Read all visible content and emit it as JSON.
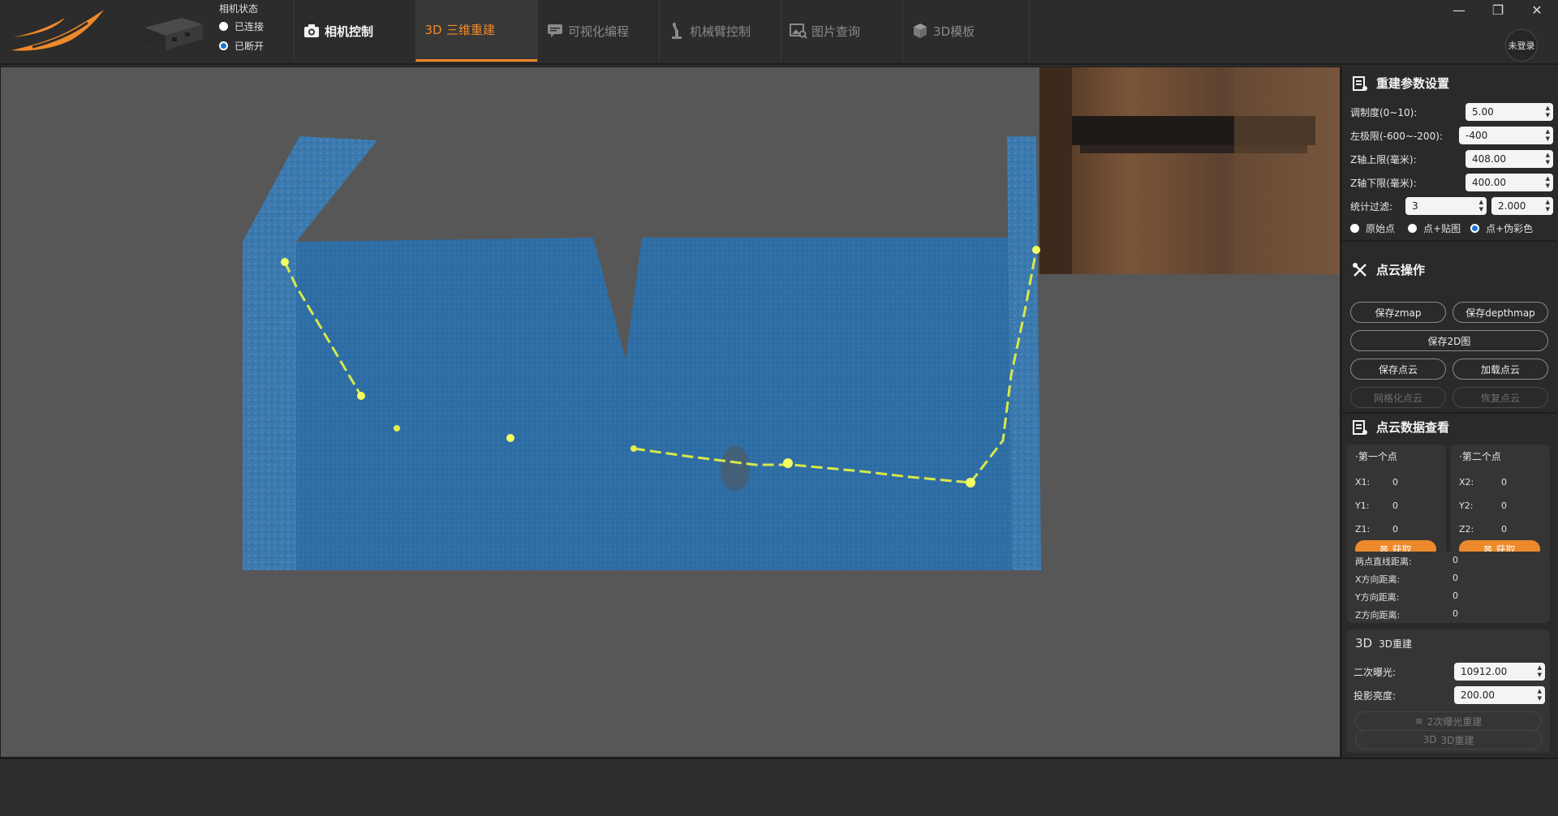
{
  "camera_status": {
    "title": "相机状态",
    "options": [
      "已连接",
      "已断开"
    ],
    "selected": "已断开"
  },
  "tabs": [
    {
      "label": "相机控制",
      "icon": "camera-icon",
      "state": "bright"
    },
    {
      "label": "三维重建",
      "icon": "3d-icon",
      "icon_text": "3D",
      "state": "active"
    },
    {
      "label": "可视化编程",
      "icon": "chat-bubble-icon",
      "state": "normal"
    },
    {
      "label": "机械臂控制",
      "icon": "robot-arm-icon",
      "state": "normal"
    },
    {
      "label": "图片查询",
      "icon": "image-search-icon",
      "state": "normal"
    },
    {
      "label": "3D模板",
      "icon": "cube-icon",
      "state": "normal"
    }
  ],
  "login": "未登录",
  "window_controls": {
    "minimize": "—",
    "restore": "❐",
    "close": "✕"
  },
  "recon_params": {
    "title": "重建参数设置",
    "modulation_label": "调制度(0~10):",
    "modulation_value": "5.00",
    "left_limit_label": "左极限(-600~-200):",
    "left_limit_value": "-400",
    "z_upper_label": "Z轴上限(毫米):",
    "z_upper_value": "408.00",
    "z_lower_label": "Z轴下限(毫米):",
    "z_lower_value": "400.00",
    "stat_filter_label": "统计过滤:",
    "stat_filter_value1": "3",
    "stat_filter_value2": "2.000",
    "display_modes": [
      "原始点",
      "点+贴图",
      "点+伪彩色"
    ],
    "display_mode_selected": "点+伪彩色"
  },
  "cloud_ops": {
    "title": "点云操作",
    "save_zmap": "保存zmap",
    "save_depthmap": "保存depthmap",
    "save_2d": "保存2D图",
    "save_cloud": "保存点云",
    "load_cloud": "加载点云",
    "mesh_cloud": "网格化点云",
    "restore_cloud": "恢复点云"
  },
  "cloud_view": {
    "title": "点云数据查看",
    "first_point": {
      "title": "第一个点",
      "x_label": "X1:",
      "x": "0",
      "y_label": "Y1:",
      "y": "0",
      "z_label": "Z1:",
      "z": "0",
      "button": "获取"
    },
    "second_point": {
      "title": "第二个点",
      "x_label": "X2:",
      "x": "0",
      "y_label": "Y2:",
      "y": "0",
      "z_label": "Z2:",
      "z": "0",
      "button": "获取"
    },
    "distance_label": "两点直线距离:",
    "distance": "0",
    "x_dist_label": "X方向距离:",
    "x_dist": "0",
    "y_dist_label": "Y方向距离:",
    "y_dist": "0",
    "z_dist_label": "Z方向距离:",
    "z_dist": "0"
  },
  "recon3d": {
    "icon_text": "3D",
    "title": "3D重建",
    "second_exposure_label": "二次曝光:",
    "second_exposure_value": "10912.00",
    "projection_brightness_label": "投影亮度:",
    "projection_brightness_value": "200.00",
    "second_exposure_btn": "2次曝光重建",
    "recon_btn": "3D重建",
    "recon_btn_icon_text": "3D"
  }
}
